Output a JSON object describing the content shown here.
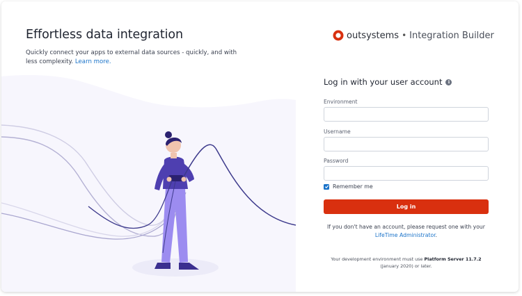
{
  "hero": {
    "title": "Effortless data integration",
    "subtitle": "Quickly connect your apps to external data sources - quickly, and with less complexity.",
    "learn_more": "Learn more."
  },
  "brand": {
    "name": "outsystems",
    "separator": "•",
    "product": "Integration Builder",
    "logo_color": "#d9300f"
  },
  "login": {
    "title": "Log in with your user account",
    "info_icon": "i",
    "environment_label": "Environment",
    "environment_value": "",
    "username_label": "Username",
    "username_value": "",
    "password_label": "Password",
    "password_value": "",
    "remember_label": "Remember me",
    "remember_checked": true,
    "button_label": "Log in",
    "button_color": "#d9300f"
  },
  "notes": {
    "account_prefix": "If you don't have an account, please request one with your ",
    "account_link": "LifeTime Administrator",
    "account_suffix": ".",
    "env_prefix": "Your development environment must use ",
    "env_version": "Platform Server 11.7.2",
    "env_suffix": " (January 2020) or later."
  }
}
